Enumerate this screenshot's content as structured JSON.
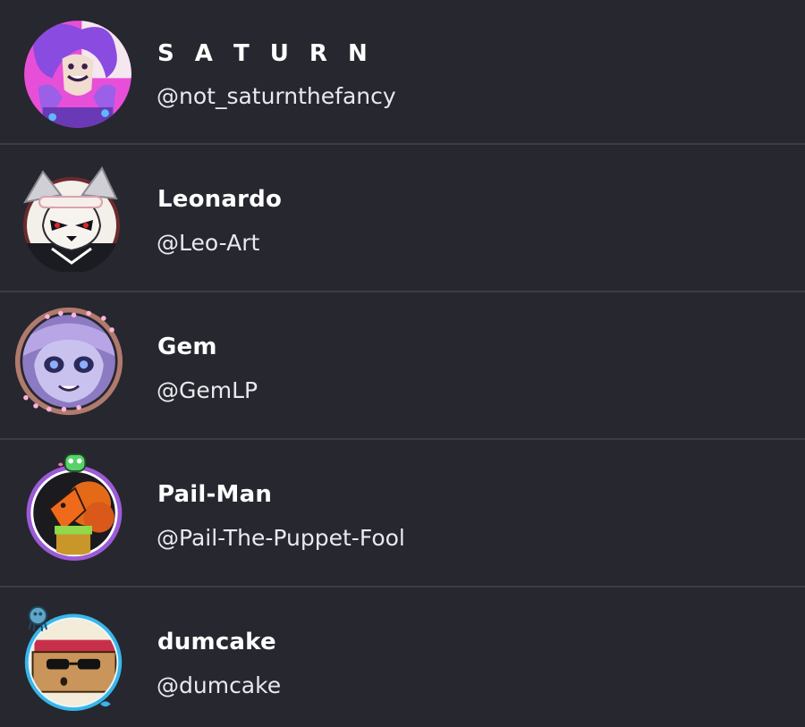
{
  "users": [
    {
      "name": "S A T U R N",
      "handle": "@not_saturnthefancy",
      "avatar_icon": "purple-haired-character-avatar"
    },
    {
      "name": "Leonardo",
      "handle": "@Leo-Art",
      "avatar_icon": "masked-wolf-character-avatar"
    },
    {
      "name": "Gem",
      "handle": "@GemLP",
      "avatar_icon": "lavender-wolf-character-avatar"
    },
    {
      "name": "Pail-Man",
      "handle": "@Pail-The-Puppet-Fool",
      "avatar_icon": "orange-puppet-character-avatar"
    },
    {
      "name": "dumcake",
      "handle": "@dumcake",
      "avatar_icon": "cake-character-avatar"
    }
  ],
  "colors": {
    "background": "#26272f",
    "divider": "#3b3c45",
    "text": "#ffffff"
  }
}
